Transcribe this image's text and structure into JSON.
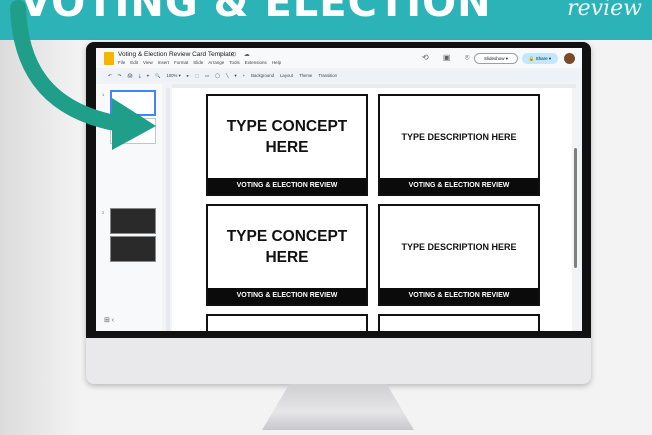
{
  "banner": {
    "headline": "VOTING & ELECTION",
    "script": "review"
  },
  "app": {
    "doc_title": "Voting & Election Review Card Template",
    "doc_icons": "☆ ⊡ ☁",
    "menu": [
      "File",
      "Edit",
      "View",
      "Insert",
      "Format",
      "Slide",
      "Arrange",
      "Tools",
      "Extensions",
      "Help"
    ],
    "slideshow_label": "Slideshow ▾",
    "share_label": "🔒 Share ▾",
    "toolbar_items": [
      "↶",
      "↷",
      "🖨",
      "⤓",
      "⌖",
      "🔍",
      "100% ▾",
      "▸",
      "⬚",
      "▭",
      "◯",
      "╲",
      "▾",
      "+",
      "Background",
      "Layout",
      "Theme",
      "Transition"
    ],
    "grid_icon": "⊞ ‹",
    "thumbnails": [
      {
        "num": "1",
        "dark": false,
        "selected": true
      },
      {
        "num": "",
        "dark": false,
        "selected": false
      },
      {
        "num": "2",
        "dark": true,
        "selected": false
      },
      {
        "num": "",
        "dark": true,
        "selected": false
      }
    ]
  },
  "cards": [
    {
      "main": "TYPE CONCEPT HERE",
      "kind": "concept",
      "footer": "VOTING & ELECTION REVIEW"
    },
    {
      "main": "TYPE DESCRIPTION HERE",
      "kind": "desc",
      "footer": "VOTING & ELECTION REVIEW"
    },
    {
      "main": "TYPE CONCEPT HERE",
      "kind": "concept",
      "footer": "VOTING & ELECTION REVIEW"
    },
    {
      "main": "TYPE DESCRIPTION HERE",
      "kind": "desc",
      "footer": "VOTING & ELECTION REVIEW"
    }
  ],
  "colors": {
    "banner": "#2bb3b8",
    "arrow": "#1f9e8a",
    "card_footer": "#0b0b0b",
    "share": "#c2e7ff"
  },
  "icons": {
    "apple_logo": "apple-logo-icon",
    "arrow": "curved-arrow-icon"
  }
}
